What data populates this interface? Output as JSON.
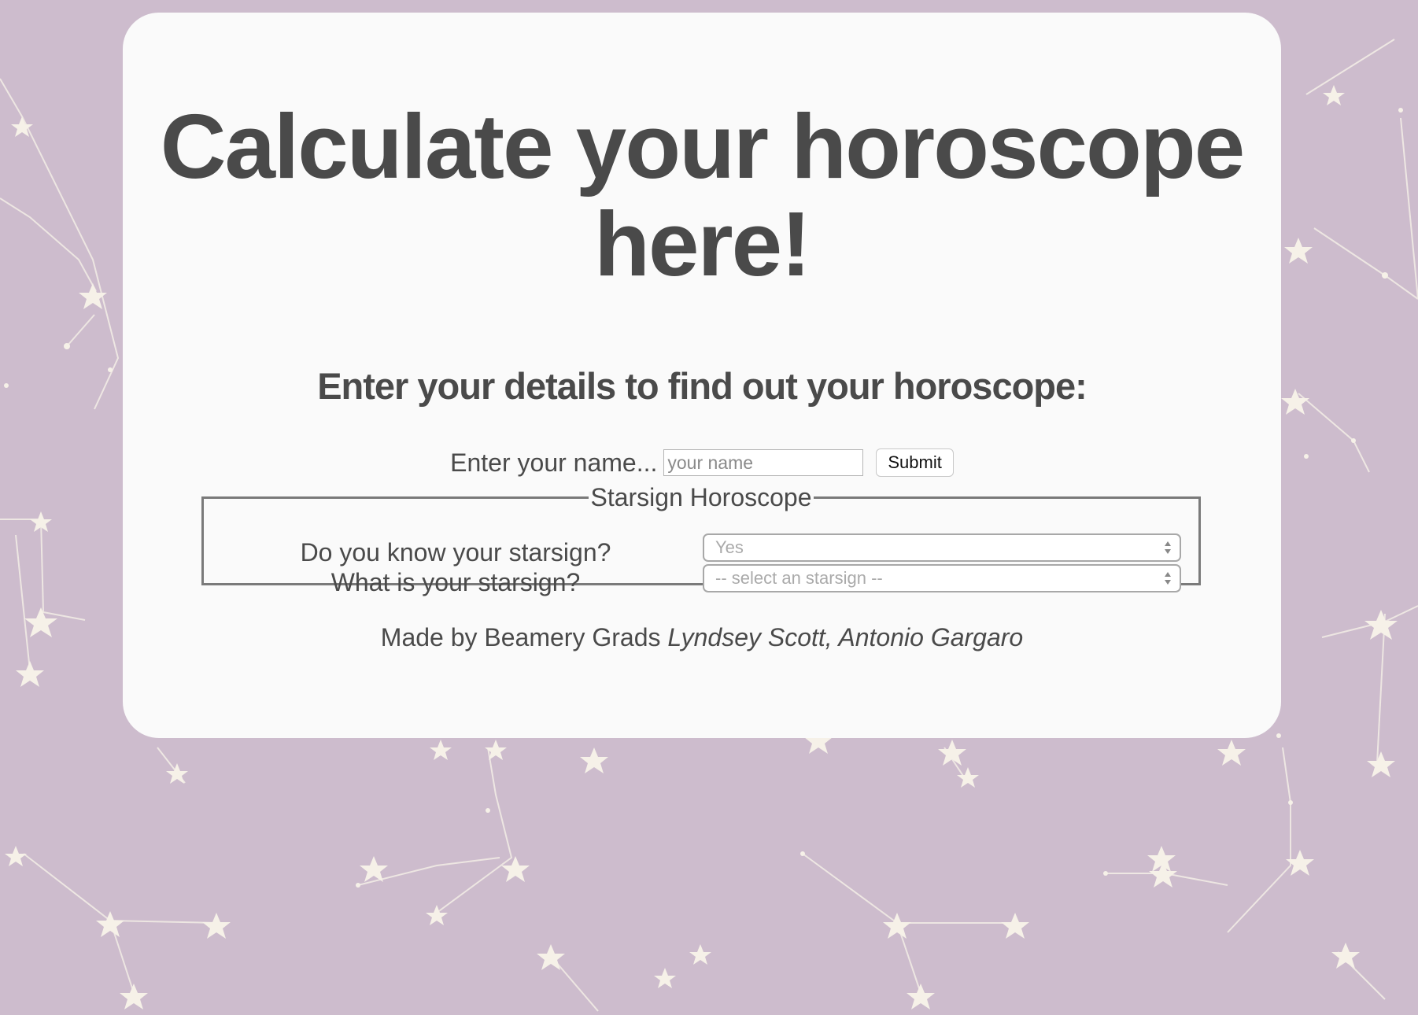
{
  "colors": {
    "background": "#cdbccd",
    "card": "#fafafa",
    "text": "#4a4a4a",
    "star": "#f5f0e6"
  },
  "header": {
    "title": "Calculate your horoscope here!",
    "subtitle": "Enter your details to find out your horoscope:"
  },
  "name_form": {
    "label": "Enter your name...",
    "placeholder": "your name",
    "submit_label": "Submit"
  },
  "starsign_section": {
    "legend": "Starsign Horoscope",
    "question_know": "Do you know your starsign?",
    "question_what": "What is your starsign?",
    "know_select_value": "Yes",
    "starsign_select_value": "-- select an starsign --"
  },
  "footer": {
    "made_by": "Made by Beamery Grads",
    "authors": "Lyndsey Scott, Antonio Gargaro"
  }
}
